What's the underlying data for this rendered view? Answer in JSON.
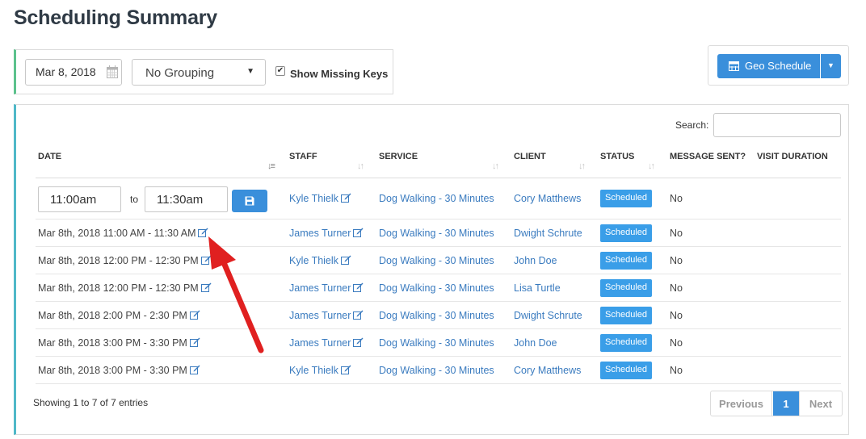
{
  "page": {
    "title": "Scheduling Summary"
  },
  "filters": {
    "date_value": "Mar 8, 2018",
    "grouping_value": "No Grouping",
    "show_missing_keys_label": "Show Missing Keys",
    "show_missing_keys_checked": true
  },
  "geo": {
    "button_label": "Geo Schedule"
  },
  "table": {
    "search_label": "Search:",
    "columns": [
      "DATE",
      "STAFF",
      "SERVICE",
      "CLIENT",
      "STATUS",
      "MESSAGE SENT?",
      "VISIT DURATION"
    ],
    "edit_row": {
      "from_time": "11:00am",
      "to_label": "to",
      "to_time": "11:30am",
      "staff": "Kyle Thielk",
      "service": "Dog Walking - 30 Minutes",
      "client": "Cory Matthews",
      "status": "Scheduled",
      "message_sent": "No"
    },
    "rows": [
      {
        "date": "Mar 8th, 2018 11:00 AM - 11:30 AM",
        "staff": "James Turner",
        "service": "Dog Walking - 30 Minutes",
        "client": "Dwight Schrute",
        "status": "Scheduled",
        "message_sent": "No"
      },
      {
        "date": "Mar 8th, 2018 12:00 PM - 12:30 PM",
        "staff": "Kyle Thielk",
        "service": "Dog Walking - 30 Minutes",
        "client": "John Doe",
        "status": "Scheduled",
        "message_sent": "No"
      },
      {
        "date": "Mar 8th, 2018 12:00 PM - 12:30 PM",
        "staff": "James Turner",
        "service": "Dog Walking - 30 Minutes",
        "client": "Lisa Turtle",
        "status": "Scheduled",
        "message_sent": "No"
      },
      {
        "date": "Mar 8th, 2018 2:00 PM - 2:30 PM",
        "staff": "James Turner",
        "service": "Dog Walking - 30 Minutes",
        "client": "Dwight Schrute",
        "status": "Scheduled",
        "message_sent": "No"
      },
      {
        "date": "Mar 8th, 2018 3:00 PM - 3:30 PM",
        "staff": "James Turner",
        "service": "Dog Walking - 30 Minutes",
        "client": "John Doe",
        "status": "Scheduled",
        "message_sent": "No"
      },
      {
        "date": "Mar 8th, 2018 3:00 PM - 3:30 PM",
        "staff": "Kyle Thielk",
        "service": "Dog Walking - 30 Minutes",
        "client": "Cory Matthews",
        "status": "Scheduled",
        "message_sent": "No"
      }
    ],
    "showing_text": "Showing 1 to 7 of 7 entries",
    "pagination": {
      "previous": "Previous",
      "current": "1",
      "next": "Next"
    }
  },
  "icons": [
    "calendar-icon",
    "select-caret-icon",
    "checkbox-checked-icon",
    "save-icon",
    "edit-icon",
    "sort-icon",
    "dropdown-caret-icon",
    "annotation-arrow"
  ],
  "colors": {
    "primary": "#3a8fdb",
    "link": "#3a7bbf",
    "badge": "#3a9ee8",
    "filter_accent": "#5cc28c",
    "table_accent": "#4fb8c8",
    "arrow": "#e02020"
  }
}
